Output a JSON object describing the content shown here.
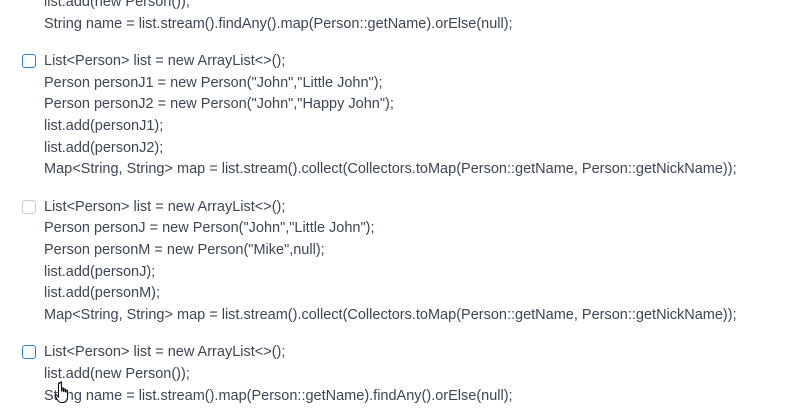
{
  "options": [
    {
      "lines": [
        "list.add(new Person());",
        "String name = list.stream().findAny().map(Person::getName).orElse(null);"
      ]
    },
    {
      "lines": [
        "List<Person> list = new ArrayList<>();",
        "Person personJ1 = new Person(\"John\",\"Little John\");",
        "Person personJ2 = new Person(\"John\",\"Happy John\");",
        "list.add(personJ1);",
        "list.add(personJ2);",
        "Map<String, String> map = list.stream().collect(Collectors.toMap(Person::getName, Person::getNickName));"
      ]
    },
    {
      "lines": [
        "List<Person> list = new ArrayList<>();",
        "Person personJ = new Person(\"John\",\"Little John\");",
        "Person personM = new Person(\"Mike\",null);",
        "list.add(personJ);",
        "list.add(personM);",
        "Map<String, String> map = list.stream().collect(Collectors.toMap(Person::getName, Person::getNickName));"
      ]
    },
    {
      "lines": [
        "List<Person> list = new ArrayList<>();",
        "list.add(new Person());",
        "String name = list.stream().map(Person::getName).findAny().orElse(null);"
      ]
    }
  ],
  "colors": {
    "checkbox_accent": "#2f7fd6",
    "checkbox_faded": "#c9cdd3",
    "text": "#3d4654"
  }
}
